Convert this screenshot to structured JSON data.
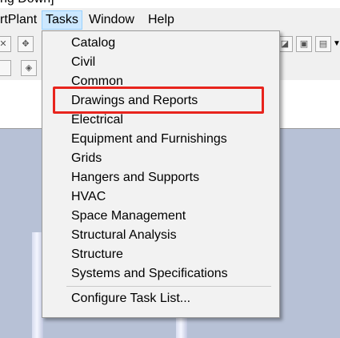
{
  "window": {
    "title_fragment": "ng Down]"
  },
  "menubar": {
    "items": [
      {
        "label": "rtPlant"
      },
      {
        "label": "Tasks",
        "active": true
      },
      {
        "label": "Window"
      },
      {
        "label": "Help"
      }
    ]
  },
  "tasks_menu": {
    "items": [
      {
        "label": "Catalog"
      },
      {
        "label": "Civil"
      },
      {
        "label": "Common"
      },
      {
        "label": "Drawings and Reports",
        "highlighted": true
      },
      {
        "label": "Electrical"
      },
      {
        "label": "Equipment and Furnishings"
      },
      {
        "label": "Grids"
      },
      {
        "label": "Hangers and Supports"
      },
      {
        "label": "HVAC"
      },
      {
        "label": "Space Management"
      },
      {
        "label": "Structural Analysis"
      },
      {
        "label": "Structure"
      },
      {
        "label": "Systems and Specifications"
      }
    ],
    "configure_label": "Configure Task List..."
  },
  "colors": {
    "menu_bg": "#f2f2f2",
    "active_menu_bg": "#cce8ff",
    "highlight_border": "#e8241d",
    "workspace_bg": "#b7c1d6"
  },
  "icons": {
    "toolbar_left": [
      "close-icon",
      "move-icon"
    ],
    "toolbar_right": [
      "select-tool-icon",
      "view-icon",
      "options-icon",
      "dropdown-arrow-icon"
    ]
  }
}
